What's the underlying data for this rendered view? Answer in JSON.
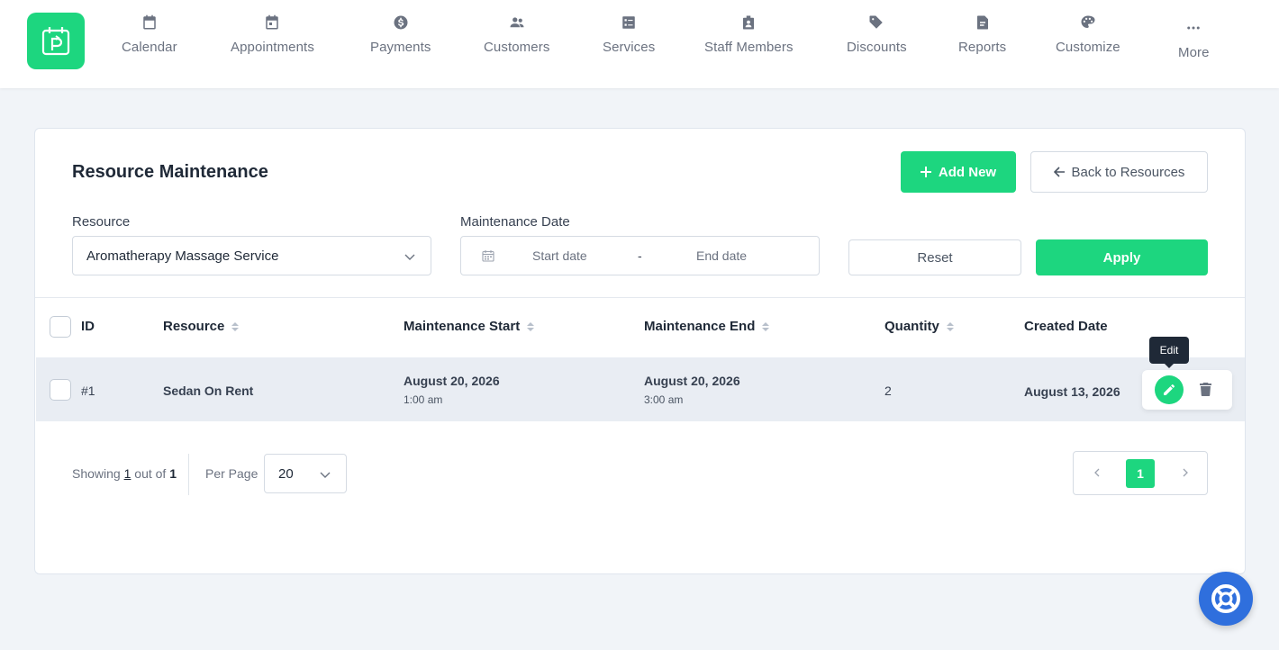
{
  "nav": {
    "items": [
      {
        "label": "Calendar",
        "icon": "calendar-icon"
      },
      {
        "label": "Appointments",
        "icon": "calendar-check-icon"
      },
      {
        "label": "Payments",
        "icon": "dollar-circle-icon"
      },
      {
        "label": "Customers",
        "icon": "users-icon"
      },
      {
        "label": "Services",
        "icon": "list-icon"
      },
      {
        "label": "Staff Members",
        "icon": "badge-icon"
      },
      {
        "label": "Discounts",
        "icon": "tag-icon"
      },
      {
        "label": "Reports",
        "icon": "file-icon"
      },
      {
        "label": "Customize",
        "icon": "palette-icon"
      },
      {
        "label": "More",
        "icon": "ellipsis-icon"
      }
    ]
  },
  "page": {
    "title": "Resource Maintenance",
    "add_label": "Add New",
    "back_label": "Back to Resources"
  },
  "filters": {
    "resource_label": "Resource",
    "resource_value": "Aromatherapy Massage Service",
    "date_label": "Maintenance Date",
    "start_placeholder": "Start date",
    "separator": "-",
    "end_placeholder": "End date",
    "reset_label": "Reset",
    "apply_label": "Apply"
  },
  "table": {
    "columns": [
      "ID",
      "Resource",
      "Maintenance Start",
      "Maintenance End",
      "Quantity",
      "Created Date"
    ],
    "rows": [
      {
        "id": "#1",
        "resource": "Sedan On Rent",
        "start_date": "August 20, 2026",
        "start_time": "1:00 am",
        "end_date": "August 20, 2026",
        "end_time": "3:00 am",
        "quantity": "2",
        "created": "August 13, 2026"
      }
    ],
    "tooltip": "Edit"
  },
  "footer": {
    "showing_prefix": "Showing",
    "showing_count": "1",
    "showing_mid": "out of",
    "showing_total": "1",
    "per_page_label": "Per Page",
    "per_page_value": "20",
    "current_page": "1"
  },
  "colors": {
    "accent": "#1dd67f",
    "help": "#2f6fdd"
  }
}
